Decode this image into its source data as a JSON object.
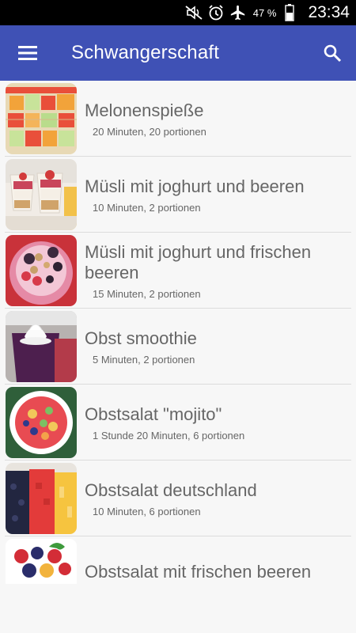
{
  "status_bar": {
    "battery_percent": "47 %",
    "time": "23:34",
    "icons": [
      "mute-icon",
      "alarm-icon",
      "airplane-icon",
      "battery-icon"
    ]
  },
  "app_bar": {
    "title": "Schwangerschaft",
    "menu_icon": "hamburger-menu-icon",
    "search_icon": "search-icon"
  },
  "recipes": [
    {
      "title": "Melonenspieße",
      "subtitle": "20 Minuten, 20 portionen"
    },
    {
      "title": "Müsli mit joghurt und beeren",
      "subtitle": "10 Minuten, 2 portionen"
    },
    {
      "title": "Müsli mit joghurt und frischen beeren",
      "subtitle": "15 Minuten, 2 portionen"
    },
    {
      "title": "Obst smoothie",
      "subtitle": "5 Minuten, 2 portionen"
    },
    {
      "title": "Obstsalat \"mojito\"",
      "subtitle": "1 Stunde 20 Minuten, 6 portionen"
    },
    {
      "title": "Obstsalat deutschland",
      "subtitle": "10 Minuten, 6 portionen"
    },
    {
      "title": "Obstsalat mit frischen beeren",
      "subtitle": ""
    }
  ]
}
